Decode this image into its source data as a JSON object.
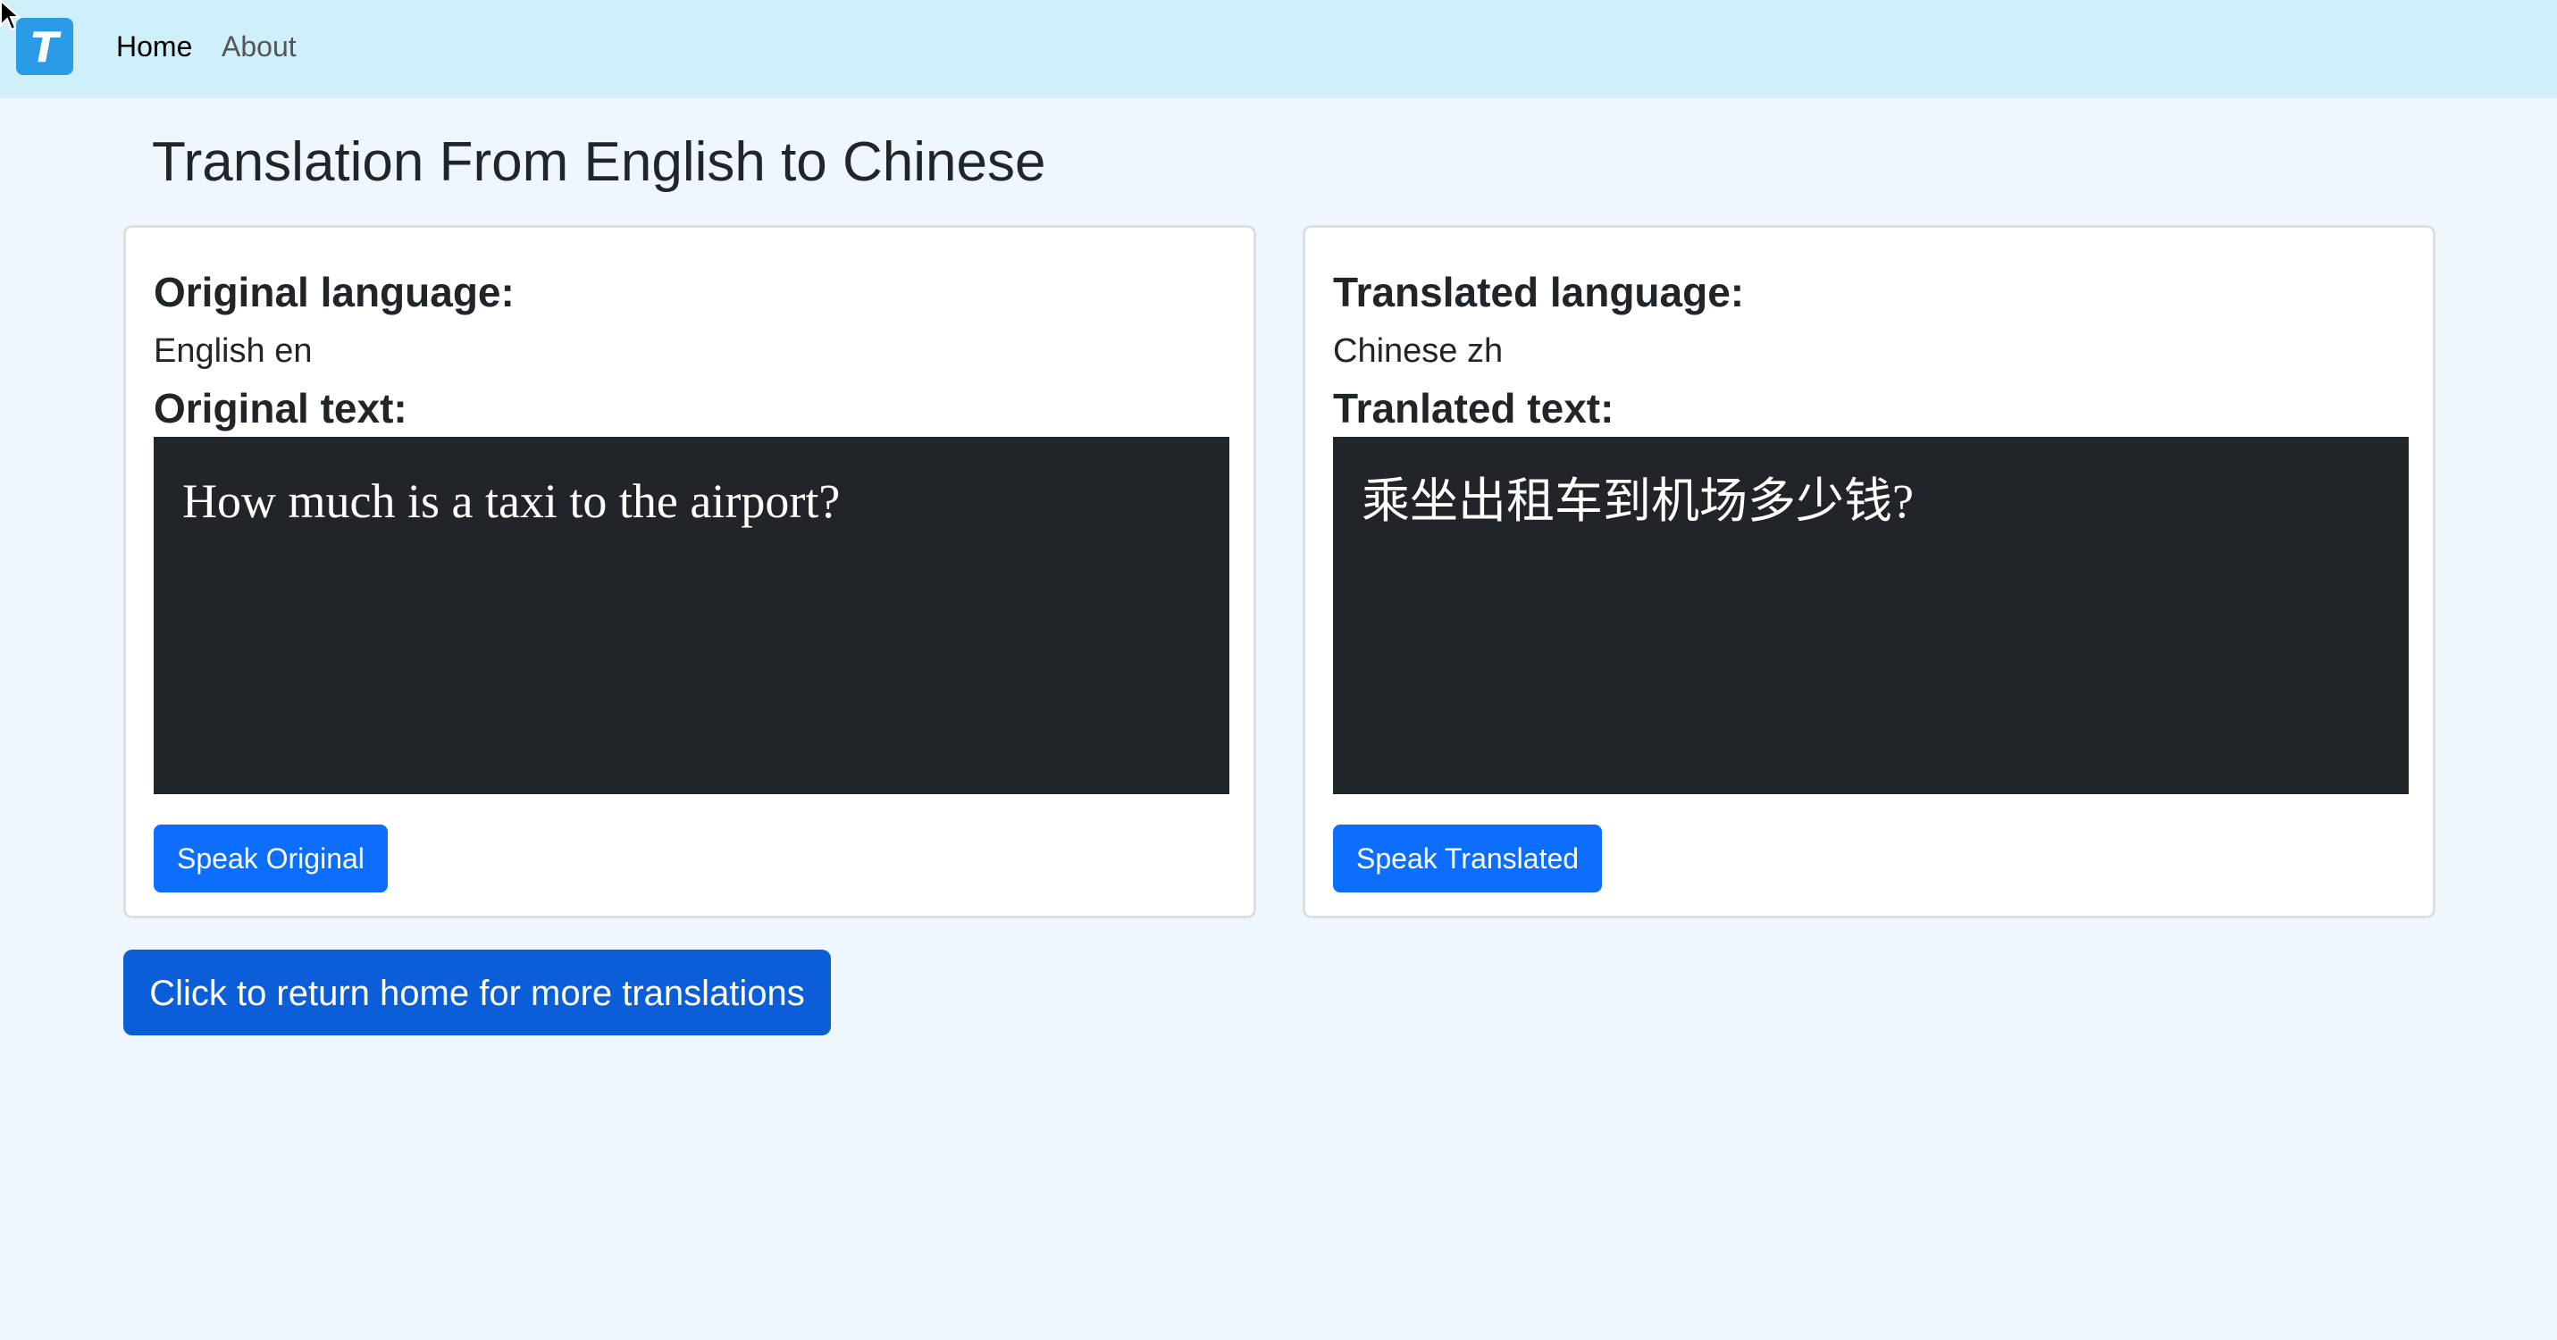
{
  "nav": {
    "logo_letter": "T",
    "links": [
      {
        "label": "Home",
        "active": true
      },
      {
        "label": "About",
        "active": false
      }
    ]
  },
  "page": {
    "title": "Translation From English to Chinese"
  },
  "original": {
    "language_label": "Original language:",
    "language_value": "English en",
    "text_label": "Original text:",
    "text": "How much is a taxi to the airport?",
    "speak_button": "Speak Original"
  },
  "translated": {
    "language_label": "Translated language:",
    "language_value": "Chinese zh",
    "text_label": "Tranlated text:",
    "text": "乘坐出租车到机场多少钱?",
    "speak_button": "Speak Translated"
  },
  "return_button": "Click to return home for more translations",
  "colors": {
    "navbar_bg": "#cff0fa",
    "page_bg": "#eef6fe",
    "primary": "#0d6efd",
    "textbox_bg": "#212529"
  },
  "icons": {
    "logo": "t-logo-icon",
    "cursor": "mouse-cursor-icon"
  }
}
